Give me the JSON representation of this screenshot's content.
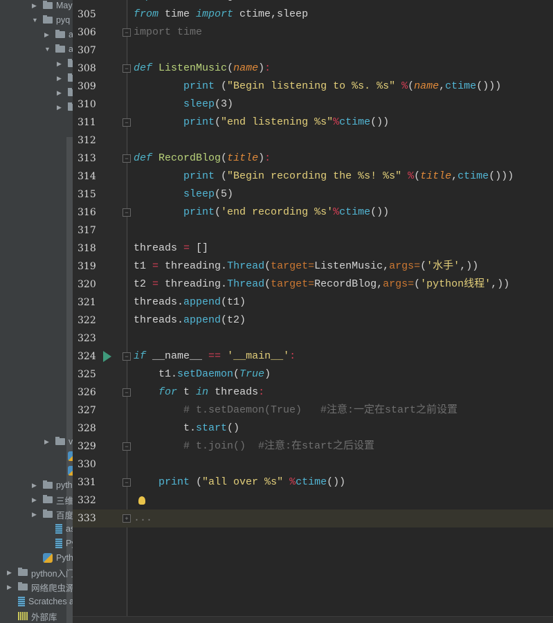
{
  "project_tree": [
    {
      "label": "May",
      "type": "folder",
      "arrow": "right",
      "depth": 2,
      "row": 0
    },
    {
      "label": "pyq",
      "type": "folder",
      "arrow": "down",
      "depth": 2,
      "row": 1
    },
    {
      "label": "a",
      "type": "folder",
      "arrow": "right",
      "depth": 3,
      "row": 2
    },
    {
      "label": "a",
      "type": "folder",
      "arrow": "down",
      "depth": 3,
      "row": 3
    },
    {
      "label": "",
      "type": "folder",
      "arrow": "right",
      "depth": 4,
      "row": 4
    },
    {
      "label": "",
      "type": "folder",
      "arrow": "right",
      "depth": 4,
      "row": 5
    },
    {
      "label": "",
      "type": "folder",
      "arrow": "right",
      "depth": 4,
      "row": 6
    },
    {
      "label": "",
      "type": "folder",
      "arrow": "right",
      "depth": 4,
      "row": 7
    },
    {
      "label": "v",
      "type": "folder",
      "arrow": "right",
      "depth": 3,
      "row": 30
    },
    {
      "label": "-",
      "type": "pyfile",
      "arrow": "",
      "depth": 4,
      "row": 31
    },
    {
      "label": "l",
      "type": "pyfile",
      "arrow": "",
      "depth": 4,
      "row": 32
    },
    {
      "label": "pyth",
      "type": "folder",
      "arrow": "right",
      "depth": 2,
      "row": 33
    },
    {
      "label": "三维",
      "type": "folder",
      "arrow": "right",
      "depth": 2,
      "row": 34
    },
    {
      "label": "百度",
      "type": "folder",
      "arrow": "right",
      "depth": 2,
      "row": 35
    },
    {
      "label": "assi",
      "type": "file",
      "arrow": "",
      "depth": 3,
      "row": 36
    },
    {
      "label": "PyM",
      "type": "file",
      "arrow": "",
      "depth": 3,
      "row": 37
    },
    {
      "label": "Python",
      "type": "pyfile",
      "arrow": "",
      "depth": 2,
      "row": 38
    },
    {
      "label": "python入门",
      "type": "folder",
      "arrow": "right",
      "depth": 0,
      "row": 39
    },
    {
      "label": "网络爬虫源",
      "type": "folder",
      "arrow": "right",
      "depth": 0,
      "row": 40
    },
    {
      "label": "Scratches and",
      "type": "file",
      "arrow": "",
      "depth": 0,
      "row": 41
    },
    {
      "label": "外部库",
      "type": "lib",
      "arrow": "",
      "depth": 0,
      "row": 42
    }
  ],
  "editor": {
    "current_line": 333,
    "lines": [
      {
        "n": 304,
        "segs": [
          [
            "import ",
            "kw"
          ],
          [
            "threading",
            ""
          ]
        ]
      },
      {
        "n": 305,
        "segs": [
          [
            "from",
            "kw"
          ],
          [
            " time ",
            ""
          ],
          [
            "import",
            "kw"
          ],
          [
            " ctime,sleep",
            ""
          ]
        ]
      },
      {
        "n": 306,
        "segs": [
          [
            "import time",
            "cm"
          ]
        ],
        "fold": "end"
      },
      {
        "n": 307,
        "segs": []
      },
      {
        "n": 308,
        "segs": [
          [
            "def",
            "kw"
          ],
          [
            " ",
            ""
          ],
          [
            "ListenMusic",
            "fn"
          ],
          [
            "(",
            ""
          ],
          [
            "name",
            "par"
          ],
          [
            ")",
            ""
          ],
          [
            ":",
            "op"
          ]
        ],
        "fold": "start"
      },
      {
        "n": 309,
        "segs": [
          [
            "        ",
            ""
          ],
          [
            "print",
            "bi"
          ],
          [
            " (",
            ""
          ],
          [
            "\"Begin listening to %s. %s\"",
            "str"
          ],
          [
            " ",
            ""
          ],
          [
            "%",
            "op"
          ],
          [
            "(",
            ""
          ],
          [
            "name",
            "par"
          ],
          [
            ",",
            ""
          ],
          [
            "ctime",
            "bi"
          ],
          [
            "()))",
            ""
          ]
        ]
      },
      {
        "n": 310,
        "segs": [
          [
            "        ",
            ""
          ],
          [
            "sleep",
            "bi"
          ],
          [
            "(3)",
            ""
          ]
        ]
      },
      {
        "n": 311,
        "segs": [
          [
            "        ",
            ""
          ],
          [
            "print",
            "bi"
          ],
          [
            "(",
            ""
          ],
          [
            "\"end listening %s\"",
            "str"
          ],
          [
            "%",
            "op"
          ],
          [
            "ctime",
            "bi"
          ],
          [
            "())",
            ""
          ]
        ],
        "fold": "end"
      },
      {
        "n": 312,
        "segs": []
      },
      {
        "n": 313,
        "segs": [
          [
            "def",
            "kw"
          ],
          [
            " ",
            ""
          ],
          [
            "RecordBlog",
            "fn"
          ],
          [
            "(",
            ""
          ],
          [
            "title",
            "par"
          ],
          [
            ")",
            ""
          ],
          [
            ":",
            "op"
          ]
        ],
        "fold": "start"
      },
      {
        "n": 314,
        "segs": [
          [
            "        ",
            ""
          ],
          [
            "print",
            "bi"
          ],
          [
            " (",
            ""
          ],
          [
            "\"Begin recording the %s! %s\"",
            "str"
          ],
          [
            " ",
            ""
          ],
          [
            "%",
            "op"
          ],
          [
            "(",
            ""
          ],
          [
            "title",
            "par"
          ],
          [
            ",",
            ""
          ],
          [
            "ctime",
            "bi"
          ],
          [
            "()))",
            ""
          ]
        ]
      },
      {
        "n": 315,
        "segs": [
          [
            "        ",
            ""
          ],
          [
            "sleep",
            "bi"
          ],
          [
            "(5)",
            ""
          ]
        ]
      },
      {
        "n": 316,
        "segs": [
          [
            "        ",
            ""
          ],
          [
            "print",
            "bi"
          ],
          [
            "(",
            ""
          ],
          [
            "'end recording %s'",
            "str"
          ],
          [
            "%",
            "op"
          ],
          [
            "ctime",
            "bi"
          ],
          [
            "())",
            ""
          ]
        ],
        "fold": "end"
      },
      {
        "n": 317,
        "segs": []
      },
      {
        "n": 318,
        "segs": [
          [
            "threads ",
            ""
          ],
          [
            "=",
            "op"
          ],
          [
            " []",
            ""
          ]
        ]
      },
      {
        "n": 319,
        "segs": [
          [
            "t1 ",
            ""
          ],
          [
            "=",
            "op"
          ],
          [
            " threading.",
            ""
          ],
          [
            "Thread",
            "bi"
          ],
          [
            "(",
            ""
          ],
          [
            "target=",
            "kwarg"
          ],
          [
            "ListenMusic,",
            ""
          ],
          [
            "args=",
            "kwarg"
          ],
          [
            "(",
            ""
          ],
          [
            "'水手'",
            "str"
          ],
          [
            ",))",
            ""
          ]
        ]
      },
      {
        "n": 320,
        "segs": [
          [
            "t2 ",
            ""
          ],
          [
            "=",
            "op"
          ],
          [
            " threading.",
            ""
          ],
          [
            "Thread",
            "bi"
          ],
          [
            "(",
            ""
          ],
          [
            "target=",
            "kwarg"
          ],
          [
            "RecordBlog,",
            ""
          ],
          [
            "args=",
            "kwarg"
          ],
          [
            "(",
            ""
          ],
          [
            "'python线程'",
            "str"
          ],
          [
            ",))",
            ""
          ]
        ]
      },
      {
        "n": 321,
        "segs": [
          [
            "threads.",
            ""
          ],
          [
            "append",
            "bi"
          ],
          [
            "(t1)",
            ""
          ]
        ]
      },
      {
        "n": 322,
        "segs": [
          [
            "threads.",
            ""
          ],
          [
            "append",
            "bi"
          ],
          [
            "(t2)",
            ""
          ]
        ]
      },
      {
        "n": 323,
        "segs": []
      },
      {
        "n": 324,
        "segs": [
          [
            "if",
            "kw"
          ],
          [
            " __name__ ",
            ""
          ],
          [
            "==",
            "op"
          ],
          [
            " ",
            ""
          ],
          [
            "'__main__'",
            "str"
          ],
          [
            ":",
            "op"
          ]
        ],
        "fold": "start",
        "run": true
      },
      {
        "n": 325,
        "segs": [
          [
            "    t1.",
            ""
          ],
          [
            "setDaemon",
            "bi"
          ],
          [
            "(",
            ""
          ],
          [
            "True",
            "kw"
          ],
          [
            ")",
            ""
          ]
        ]
      },
      {
        "n": 326,
        "segs": [
          [
            "    ",
            ""
          ],
          [
            "for",
            "kw"
          ],
          [
            " t ",
            ""
          ],
          [
            "in",
            "kw"
          ],
          [
            " threads",
            ""
          ],
          [
            ":",
            "op"
          ]
        ],
        "fold": "start"
      },
      {
        "n": 327,
        "segs": [
          [
            "        ",
            ""
          ],
          [
            "# t.setDaemon(True)   #注意:一定在start之前设置",
            "cm"
          ]
        ]
      },
      {
        "n": 328,
        "segs": [
          [
            "        t.",
            ""
          ],
          [
            "start",
            "bi"
          ],
          [
            "()",
            ""
          ]
        ]
      },
      {
        "n": 329,
        "segs": [
          [
            "        ",
            ""
          ],
          [
            "# t.join()  #注意:在start之后设置",
            "cm"
          ]
        ],
        "fold": "end"
      },
      {
        "n": 330,
        "segs": []
      },
      {
        "n": 331,
        "segs": [
          [
            "    ",
            ""
          ],
          [
            "print",
            "bi"
          ],
          [
            " (",
            ""
          ],
          [
            "\"all over %s\"",
            "str"
          ],
          [
            " ",
            ""
          ],
          [
            "%",
            "op"
          ],
          [
            "ctime",
            "bi"
          ],
          [
            "())",
            ""
          ]
        ],
        "fold": "end"
      },
      {
        "n": 332,
        "segs": [],
        "bulb": true
      },
      {
        "n": 333,
        "segs": [
          [
            "...",
            "dim"
          ]
        ],
        "fold": "collapsed"
      }
    ]
  }
}
